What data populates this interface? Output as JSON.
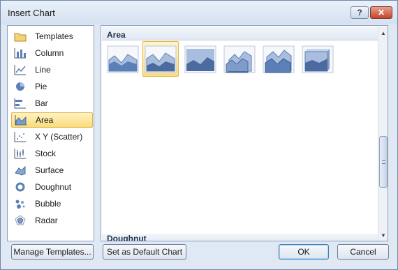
{
  "window": {
    "title": "Insert Chart",
    "help_label": "?",
    "close_label": "✕"
  },
  "categories": [
    {
      "label": "Templates",
      "icon": "folder-icon"
    },
    {
      "label": "Column",
      "icon": "column-chart-icon"
    },
    {
      "label": "Line",
      "icon": "line-chart-icon"
    },
    {
      "label": "Pie",
      "icon": "pie-chart-icon"
    },
    {
      "label": "Bar",
      "icon": "bar-chart-icon"
    },
    {
      "label": "Area",
      "icon": "area-chart-icon",
      "selected": true
    },
    {
      "label": "X Y (Scatter)",
      "icon": "scatter-chart-icon"
    },
    {
      "label": "Stock",
      "icon": "stock-chart-icon"
    },
    {
      "label": "Surface",
      "icon": "surface-chart-icon"
    },
    {
      "label": "Doughnut",
      "icon": "doughnut-chart-icon"
    },
    {
      "label": "Bubble",
      "icon": "bubble-chart-icon"
    },
    {
      "label": "Radar",
      "icon": "radar-chart-icon"
    }
  ],
  "gallery": {
    "section_title": "Area",
    "next_section_title": "Doughnut",
    "thumbnails": [
      {
        "icon": "area-chart-thumbnail-icon"
      },
      {
        "icon": "stacked-area-chart-thumbnail-icon",
        "selected": true
      },
      {
        "icon": "100-percent-stacked-area-thumbnail-icon"
      },
      {
        "icon": "3d-area-chart-thumbnail-icon"
      },
      {
        "icon": "3d-stacked-area-thumbnail-icon"
      },
      {
        "icon": "3d-100-percent-stacked-area-thumbnail-icon"
      }
    ]
  },
  "buttons": {
    "manage_templates": "Manage Templates...",
    "set_default": "Set as Default Chart",
    "ok": "OK",
    "cancel": "Cancel"
  },
  "colors": {
    "accent_selected": "#fbdc7a",
    "dialog_bg": "#dfe8f3",
    "chart_blue": "#5b7fb7"
  }
}
